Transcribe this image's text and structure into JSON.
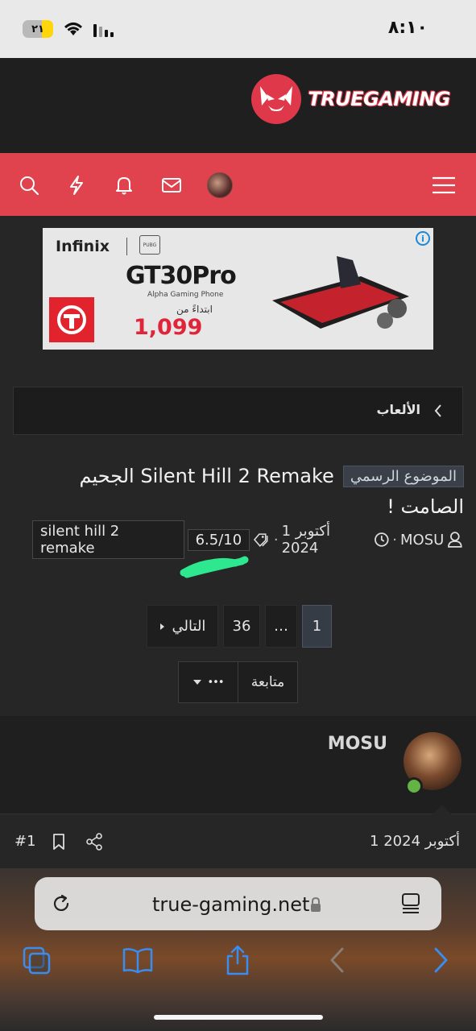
{
  "status_bar": {
    "time": "٨:١٠",
    "battery": "٢١"
  },
  "header": {
    "logo_text": "TRUEGAMING"
  },
  "nav": {
    "icons": [
      "search-icon",
      "lightning-icon",
      "bell-icon",
      "mail-icon",
      "avatar",
      "menu-icon"
    ],
    "accent": "#e0434e"
  },
  "ad": {
    "brand": "Infinix",
    "model": "GT30Pro",
    "subtitle": "Alpha Gaming Phone",
    "from_label": "ابتداءً من",
    "price": "1,099"
  },
  "breadcrumb": {
    "label": "الألعاب"
  },
  "thread": {
    "prefix": "الموضوع الرسمي",
    "title": "Silent Hill 2 Remake الجحيم الصامت !",
    "author": "MOSU",
    "date": "1 أكتوبر 2024",
    "tags": [
      "6.5/10",
      "silent hill 2 remake"
    ]
  },
  "pagination": {
    "current": "1",
    "ellipsis": "…",
    "last": "36",
    "next_label": "التالي"
  },
  "follow": {
    "label": "متابعة",
    "more": "•••"
  },
  "post": {
    "author": "MOSU",
    "date": "1 أكتوبر 2024",
    "number": "#1"
  },
  "browser": {
    "url": "true-gaming.net"
  }
}
